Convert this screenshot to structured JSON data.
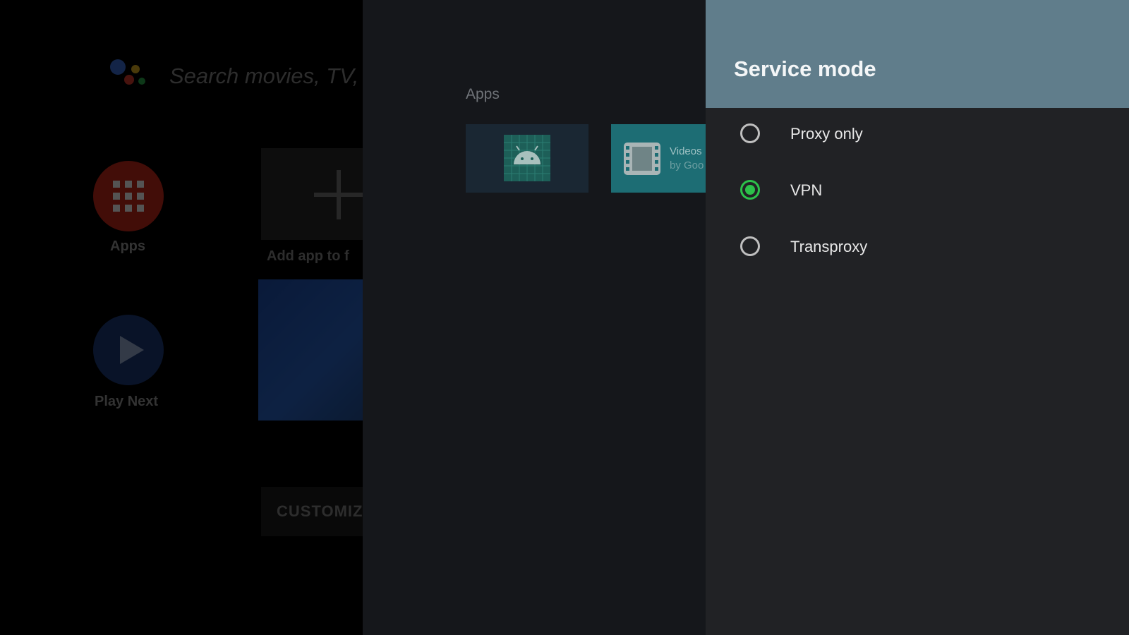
{
  "launcher": {
    "search_placeholder": "Search movies, TV, a",
    "apps_label": "Apps",
    "play_next_label": "Play Next",
    "add_app_label": "Add app to f",
    "customize_label": "CUSTOMIZE"
  },
  "apps_panel": {
    "heading": "Apps",
    "videos_tile": {
      "title": "Videos",
      "subtitle": "by Goo"
    }
  },
  "dialog": {
    "title": "Service mode",
    "options": [
      {
        "label": "Proxy only",
        "selected": false
      },
      {
        "label": "VPN",
        "selected": true
      },
      {
        "label": "Transproxy",
        "selected": false
      }
    ]
  },
  "colors": {
    "header_bg": "#607d8b",
    "panel_bg": "#212225",
    "radio_selected": "#2cc14a",
    "radio_unselected": "#bfbfbf"
  }
}
